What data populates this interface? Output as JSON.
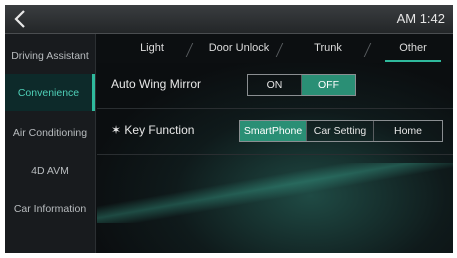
{
  "topbar": {
    "time": "AM 1:42",
    "back_icon": "chevron-left-icon"
  },
  "sidebar": {
    "items": [
      {
        "label": "Driving Assistant",
        "active": false
      },
      {
        "label": "Convenience",
        "active": true
      },
      {
        "label": "Air Conditioning",
        "active": false
      },
      {
        "label": "4D AVM",
        "active": false
      },
      {
        "label": "Car Information",
        "active": false
      }
    ]
  },
  "tabs": [
    {
      "label": "Light",
      "active": false
    },
    {
      "label": "Door Unlock",
      "active": false
    },
    {
      "label": "Trunk",
      "active": false
    },
    {
      "label": "Other",
      "active": true
    }
  ],
  "settings": {
    "wing_mirror": {
      "label": "Auto Wing Mirror",
      "options": [
        "ON",
        "OFF"
      ],
      "selected": "OFF"
    },
    "key_function": {
      "label": "✶ Key Function",
      "options": [
        "SmartPhone",
        "Car Setting",
        "Home"
      ],
      "selected": "SmartPhone"
    }
  },
  "colors": {
    "accent": "#2fb99c",
    "selected_bg": "#2a8f75",
    "background": "#0c0f11"
  }
}
